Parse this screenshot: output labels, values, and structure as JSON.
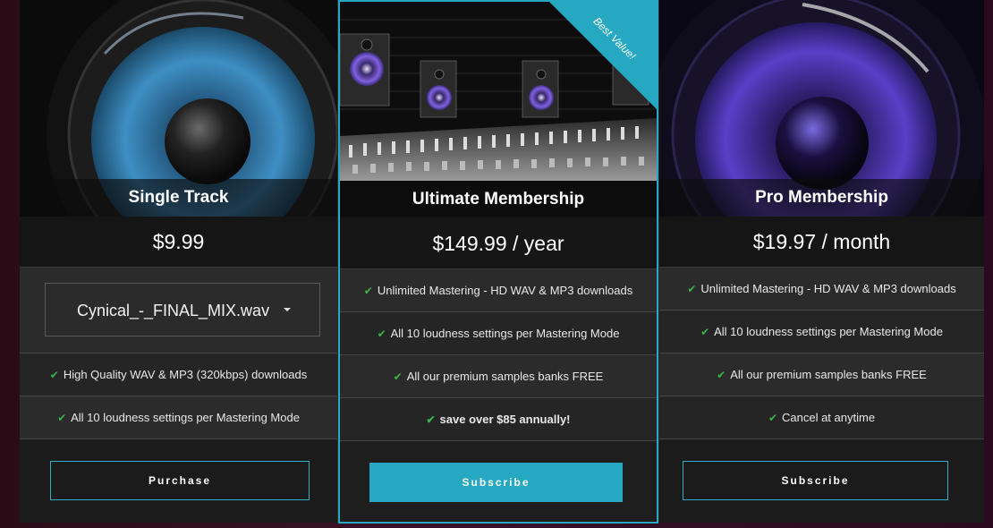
{
  "plans": [
    {
      "title": "Single Track",
      "price": "$9.99",
      "select": {
        "value": "Cynical_-_FINAL_MIX.wav"
      },
      "features": [
        "High Quality WAV & MP3 (320kbps) downloads",
        "All 10 loudness settings per Mastering Mode"
      ],
      "button": "Purchase"
    },
    {
      "title": "Ultimate Membership",
      "price": "$149.99 / year",
      "ribbon": "Best Value!",
      "features": [
        "Unlimited Mastering - HD WAV & MP3 downloads",
        "All 10 loudness settings per Mastering Mode",
        "All our premium samples banks FREE",
        "save over $85 annually!"
      ],
      "button": "Subscribe"
    },
    {
      "title": "Pro Membership",
      "price": "$19.97 / month",
      "features": [
        "Unlimited Mastering - HD WAV & MP3 downloads",
        "All 10 loudness settings per Mastering Mode",
        "All our premium samples banks FREE",
        "Cancel at anytime"
      ],
      "button": "Subscribe"
    }
  ],
  "colors": {
    "accent": "#27a8c2",
    "check": "#3bb54a",
    "card_bg": "#1b1b1b",
    "row_bg": "#2b2b2b"
  },
  "icons": {
    "feature_bullet": "check-icon",
    "select_caret": "caret-down-icon"
  }
}
